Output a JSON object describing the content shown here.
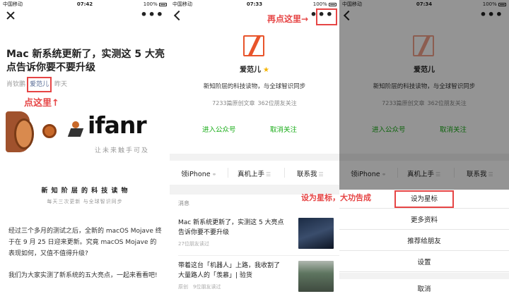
{
  "status": {
    "p1": {
      "carrier": "中国移动",
      "time": "07:42",
      "battery": "100%"
    },
    "p2": {
      "carrier": "中国移动",
      "time": "07:33",
      "battery": "100%"
    },
    "p3": {
      "carrier": "中国移动",
      "time": "07:34",
      "battery": "100%"
    }
  },
  "more_dots": "•••",
  "article": {
    "title": "Mac 新系统更新了，实测这 5 大亮点告诉你要不要升级",
    "author_left": "肖钦鹏",
    "author_boxed": "爱范儿",
    "date": "昨天",
    "annotation": "点这里↑",
    "banner_brand": "ifanr",
    "banner_slogan": "让未来触手可及",
    "heading": "新 知 阶 层 的 科 技 读 物",
    "subheading": "每天三次更新 与全球智识同步",
    "para1": "经过三个多月的测试之后，全新的 macOS Mojave 终于在 9 月 25 日迎来更新。究竟 macOS Mojave 的表现如何，又值不值得升级?",
    "para2": "我们为大家实测了新系统的五大亮点，一起来看看吧!"
  },
  "profile": {
    "annotation": "再点这里→",
    "name": "爱范儿",
    "desc": "新知阶层的科技读物，与全球智识同步",
    "articles": "7233篇原创文章",
    "friends": "362位朋友关注",
    "enter": "进入公众号",
    "unfollow": "取消关注",
    "menu": [
      "领iPhone",
      "真机上手",
      "联系我"
    ],
    "messages_label": "消息",
    "messages": [
      {
        "title": "Mac 新系统更新了，实测这 5 大亮点告诉你要不要升级",
        "meta": "27位朋友读过"
      },
      {
        "title": "带着这台「机器人」上路，我收割了大量路人的「羡慕」| 验货",
        "meta": "原创　9位朋友读过"
      }
    ]
  },
  "sheet": {
    "annotation": "设为星标，大功告成",
    "items": [
      "设为星标",
      "更多资料",
      "推荐给朋友",
      "设置"
    ],
    "cancel": "取消"
  },
  "colors": {
    "accent_red": "#e64545",
    "wechat_green": "#1aad19",
    "link_blue": "#576b95",
    "brand_orange": "#e8542b"
  }
}
